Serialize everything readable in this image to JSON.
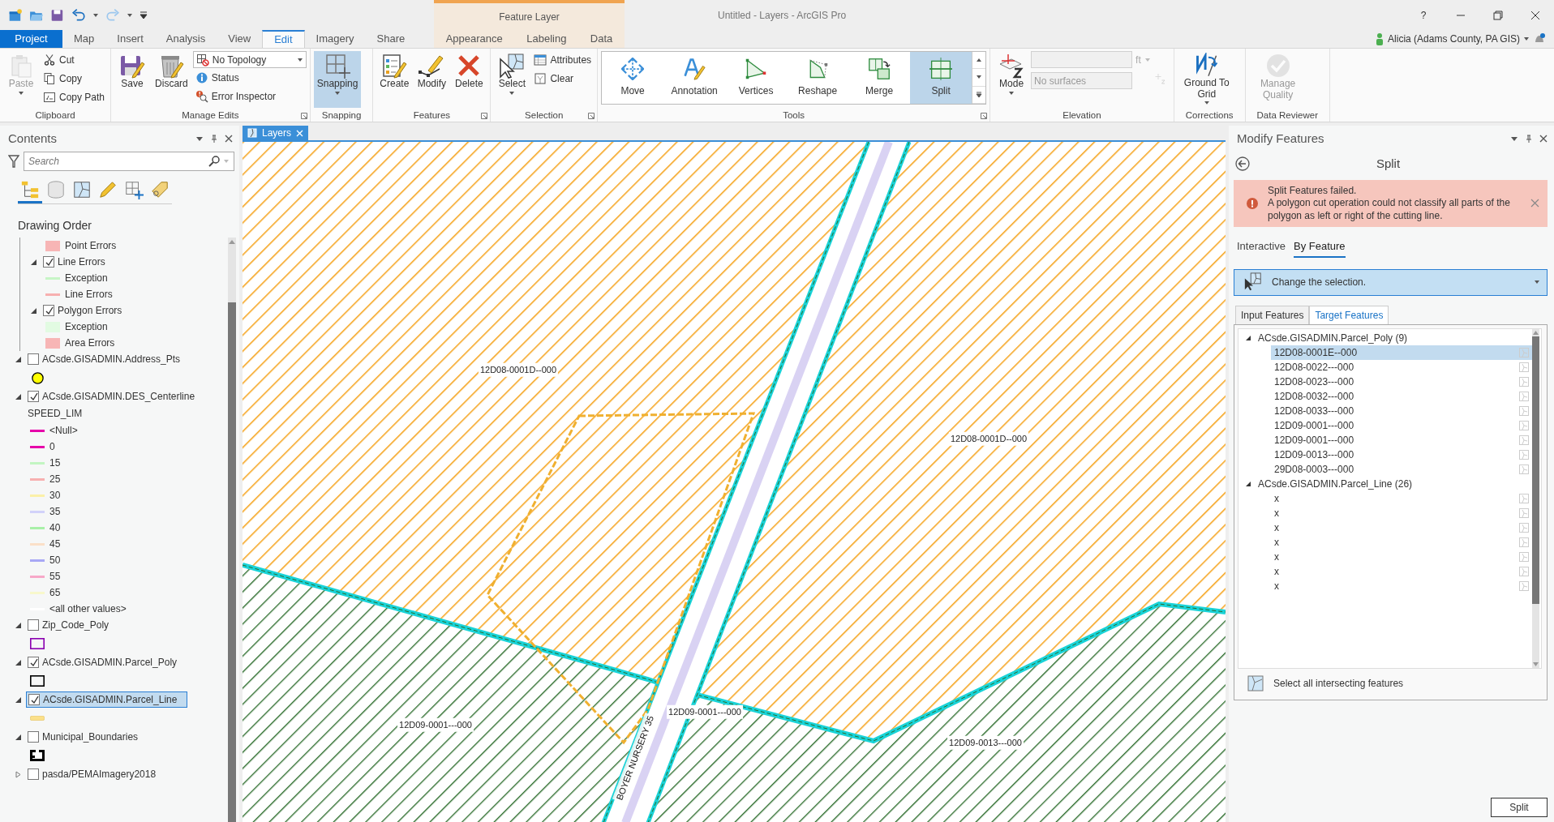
{
  "window": {
    "title": "Untitled - Layers - ArcGIS Pro",
    "help": "?",
    "user": "Alicia (Adams County, PA GIS)"
  },
  "contextual_group": {
    "title": "Feature Layer"
  },
  "tabs": [
    {
      "label": "Project",
      "kind": "backstage",
      "selected": false
    },
    {
      "label": "Map",
      "kind": "core",
      "selected": false
    },
    {
      "label": "Insert",
      "kind": "core",
      "selected": false
    },
    {
      "label": "Analysis",
      "kind": "core",
      "selected": false
    },
    {
      "label": "View",
      "kind": "core",
      "selected": false
    },
    {
      "label": "Edit",
      "kind": "core",
      "selected": true
    },
    {
      "label": "Imagery",
      "kind": "core",
      "selected": false
    },
    {
      "label": "Share",
      "kind": "core",
      "selected": false
    },
    {
      "label": "Appearance",
      "kind": "contextual",
      "selected": false
    },
    {
      "label": "Labeling",
      "kind": "contextual",
      "selected": false
    },
    {
      "label": "Data",
      "kind": "contextual",
      "selected": false
    }
  ],
  "ribbon": [
    {
      "label": "Clipboard",
      "launcher": false,
      "controls": [
        {
          "kind": "large",
          "label": "Paste",
          "disabled": true,
          "selected": false,
          "dropdown": true
        },
        {
          "kind": "small",
          "label": "Cut",
          "disabled": false,
          "selected": false
        },
        {
          "kind": "small",
          "label": "Copy",
          "disabled": false,
          "selected": false
        },
        {
          "kind": "small",
          "label": "Copy Path",
          "disabled": false,
          "selected": false
        }
      ]
    },
    {
      "label": "Manage Edits",
      "launcher": true,
      "controls": [
        {
          "kind": "large",
          "label": "Save",
          "disabled": false,
          "selected": false,
          "dropdown": false
        },
        {
          "kind": "large",
          "label": "Discard",
          "disabled": false,
          "selected": false,
          "dropdown": false
        },
        {
          "kind": "combo",
          "value": "No Topology",
          "disabled": false
        },
        {
          "kind": "small",
          "label": "Status",
          "disabled": false,
          "selected": false
        },
        {
          "kind": "small",
          "label": "Error Inspector",
          "disabled": false,
          "selected": false
        }
      ]
    },
    {
      "label": "Snapping",
      "launcher": false,
      "controls": [
        {
          "kind": "large",
          "label": "Snapping",
          "disabled": false,
          "selected": true,
          "dropdown": true
        }
      ]
    },
    {
      "label": "Features",
      "launcher": true,
      "controls": [
        {
          "kind": "large",
          "label": "Create",
          "disabled": false,
          "selected": false,
          "dropdown": false
        },
        {
          "kind": "large",
          "label": "Modify",
          "disabled": false,
          "selected": false,
          "dropdown": false
        },
        {
          "kind": "large",
          "label": "Delete",
          "disabled": false,
          "selected": false,
          "dropdown": false
        }
      ]
    },
    {
      "label": "Selection",
      "launcher": true,
      "controls": [
        {
          "kind": "large",
          "label": "Select",
          "disabled": false,
          "selected": false,
          "dropdown": true
        },
        {
          "kind": "small",
          "label": "Attributes",
          "disabled": false,
          "selected": false
        },
        {
          "kind": "small",
          "label": "Clear",
          "disabled": false,
          "selected": false
        }
      ]
    },
    {
      "label": "Tools",
      "launcher": true,
      "controls": [
        {
          "kind": "gallery",
          "items": [
            {
              "label": "Move",
              "selected": false
            },
            {
              "label": "Annotation",
              "selected": false
            },
            {
              "label": "Vertices",
              "selected": false
            },
            {
              "label": "Reshape",
              "selected": false
            },
            {
              "label": "Merge",
              "selected": false
            },
            {
              "label": "Split",
              "selected": true
            }
          ]
        }
      ]
    },
    {
      "label": "Elevation",
      "launcher": false,
      "controls": [
        {
          "kind": "large",
          "label": "Mode",
          "disabled": false,
          "selected": false,
          "dropdown": true
        },
        {
          "kind": "unit_field",
          "unit": "ft",
          "disabled": true
        },
        {
          "kind": "field",
          "value": "No surfaces",
          "disabled": true
        },
        {
          "kind": "icon_button",
          "disabled": true
        }
      ]
    },
    {
      "label": "Corrections",
      "launcher": false,
      "controls": [
        {
          "kind": "large",
          "label": "Ground To Grid",
          "disabled": false,
          "selected": false,
          "dropdown": true
        }
      ]
    },
    {
      "label": "Data Reviewer",
      "launcher": false,
      "controls": [
        {
          "kind": "large",
          "label": "Manage Quality",
          "disabled": true,
          "selected": false,
          "dropdown": false
        }
      ]
    }
  ],
  "contents": {
    "title": "Contents",
    "search": {
      "placeholder": "Search"
    },
    "view_tabs": [
      {
        "selected": true
      },
      {
        "selected": false
      },
      {
        "selected": false
      },
      {
        "selected": false
      },
      {
        "selected": false
      },
      {
        "selected": false
      }
    ],
    "heading": "Drawing Order",
    "error_group_children": [
      {
        "kind": "fill",
        "color": "#f7b5b5",
        "label": "Point Errors"
      },
      {
        "kind": "layer",
        "label": "Line Errors",
        "checked": true,
        "expanded": true,
        "selected": false,
        "legend": [
          {
            "kind": "line",
            "color": "#c6f5c6",
            "label": "Exception"
          },
          {
            "kind": "line",
            "color": "#f7b0b0",
            "label": "Line Errors"
          }
        ]
      },
      {
        "kind": "layer",
        "label": "Polygon Errors",
        "checked": true,
        "expanded": true,
        "selected": false,
        "legend": [
          {
            "kind": "fill",
            "color": "#e2fbe2",
            "label": "Exception"
          },
          {
            "kind": "fill",
            "color": "#f7b5b5",
            "label": "Area Errors"
          }
        ]
      }
    ],
    "layers": [
      {
        "kind": "layer",
        "label": "ACsde.GISADMIN.Address_Pts",
        "checked": false,
        "expanded": true,
        "selected": false,
        "legend": [
          {
            "kind": "circle",
            "color": "#ffff00"
          }
        ]
      },
      {
        "kind": "layer",
        "label": "ACsde.GISADMIN.DES_Centerline",
        "checked": true,
        "expanded": true,
        "selected": false,
        "field": "SPEED_LIM",
        "legend": [
          {
            "kind": "line",
            "color": "#e600a9",
            "label": "<Null>"
          },
          {
            "kind": "line",
            "color": "#e600a9",
            "label": "0"
          },
          {
            "kind": "line",
            "color": "#c2f5c2",
            "label": "15"
          },
          {
            "kind": "line",
            "color": "#f7b0b0",
            "label": "25"
          },
          {
            "kind": "line",
            "color": "#fbf0a8",
            "label": "30"
          },
          {
            "kind": "line",
            "color": "#d2d2fa",
            "label": "35"
          },
          {
            "kind": "line",
            "color": "#a8f0a8",
            "label": "40"
          },
          {
            "kind": "line",
            "color": "#fbe0c8",
            "label": "45"
          },
          {
            "kind": "line",
            "color": "#a8a8f5",
            "label": "50"
          },
          {
            "kind": "line",
            "color": "#f7a8c8",
            "label": "55"
          },
          {
            "kind": "line",
            "color": "#f8f8cc",
            "label": "65"
          },
          {
            "kind": "line",
            "color": "#ffffff",
            "label": "<all other values>"
          }
        ]
      },
      {
        "kind": "layer",
        "label": "Zip_Code_Poly",
        "checked": false,
        "expanded": true,
        "selected": false,
        "legend": [
          {
            "kind": "outline",
            "color": "#8a00b0"
          }
        ]
      },
      {
        "kind": "layer",
        "label": "ACsde.GISADMIN.Parcel_Poly",
        "checked": true,
        "expanded": true,
        "selected": false,
        "legend": [
          {
            "kind": "outline",
            "color": "#000000"
          }
        ]
      },
      {
        "kind": "layer",
        "label": "ACsde.GISADMIN.Parcel_Line",
        "checked": true,
        "expanded": true,
        "selected": true,
        "legend": [
          {
            "kind": "bar",
            "color": "#fbe08a"
          }
        ]
      },
      {
        "kind": "layer",
        "label": "Municipal_Boundaries",
        "checked": false,
        "expanded": true,
        "selected": false,
        "legend": [
          {
            "kind": "pattern",
            "color": "#000000"
          }
        ]
      },
      {
        "kind": "layer",
        "label": "pasda/PEMAImagery2018",
        "checked": false,
        "expanded": false,
        "selected": false
      }
    ]
  },
  "map_view": {
    "tabs": [
      {
        "label": "Layers",
        "selected": true
      }
    ],
    "labels": [
      "12D08-0001D--000",
      "12D08-0001D--000",
      "12D09-0001---000",
      "12D09-0001---000",
      "12D09-0013---000"
    ],
    "road_label": "BOYER NURSERY 35"
  },
  "modify_features": {
    "title": "Modify Features",
    "tool": "Split",
    "error": {
      "title": "Split Features failed.",
      "message": "A polygon cut operation could not classify all parts of the polygon as left or right of the cutting line."
    },
    "modes": [
      {
        "label": "Interactive",
        "selected": false
      },
      {
        "label": "By Feature",
        "selected": true
      }
    ],
    "selection_prompt": "Change the selection.",
    "feature_tabs": [
      {
        "label": "Input Features",
        "selected": false
      },
      {
        "label": "Target Features",
        "selected": true
      }
    ],
    "tree": [
      {
        "label": "ACsde.GISADMIN.Parcel_Poly (9)",
        "expanded": true,
        "items": [
          {
            "label": "12D08-0001E--000",
            "selected": true
          },
          {
            "label": "12D08-0022---000",
            "selected": false
          },
          {
            "label": "12D08-0023---000",
            "selected": false
          },
          {
            "label": "12D08-0032---000",
            "selected": false
          },
          {
            "label": "12D08-0033---000",
            "selected": false
          },
          {
            "label": "12D09-0001---000",
            "selected": false
          },
          {
            "label": "12D09-0001---000",
            "selected": false
          },
          {
            "label": "12D09-0013---000",
            "selected": false
          },
          {
            "label": "29D08-0003---000",
            "selected": false
          }
        ]
      },
      {
        "label": "ACsde.GISADMIN.Parcel_Line (26)",
        "expanded": true,
        "items": [
          {
            "label": "x",
            "selected": false
          },
          {
            "label": "x",
            "selected": false
          },
          {
            "label": "x",
            "selected": false
          },
          {
            "label": "x",
            "selected": false
          },
          {
            "label": "x",
            "selected": false
          },
          {
            "label": "x",
            "selected": false
          },
          {
            "label": "x",
            "selected": false
          }
        ]
      }
    ],
    "select_all": "Select all intersecting features",
    "apply": "Split"
  }
}
